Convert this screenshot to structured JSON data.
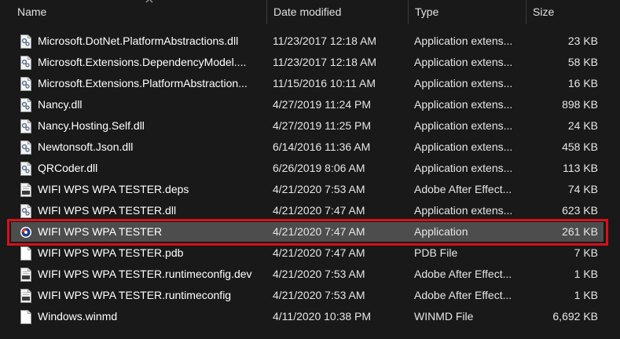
{
  "columns": {
    "name": "Name",
    "date": "Date modified",
    "type": "Type",
    "size": "Size"
  },
  "files": [
    {
      "name": "Microsoft.DotNet.PlatformAbstractions.dll",
      "date": "11/23/2017 12:18 AM",
      "type": "Application extens...",
      "size": "23 KB",
      "icon": "dll-gear-icon"
    },
    {
      "name": "Microsoft.Extensions.DependencyModel....",
      "date": "11/23/2017 12:18 AM",
      "type": "Application extens...",
      "size": "58 KB",
      "icon": "dll-gear-icon"
    },
    {
      "name": "Microsoft.Extensions.PlatformAbstraction...",
      "date": "11/15/2016 10:11 AM",
      "type": "Application extens...",
      "size": "16 KB",
      "icon": "dll-gear-icon"
    },
    {
      "name": "Nancy.dll",
      "date": "4/27/2019 11:24 PM",
      "type": "Application extens...",
      "size": "898 KB",
      "icon": "dll-gear-icon"
    },
    {
      "name": "Nancy.Hosting.Self.dll",
      "date": "4/27/2019 11:25 PM",
      "type": "Application extens...",
      "size": "24 KB",
      "icon": "dll-gear-icon"
    },
    {
      "name": "Newtonsoft.Json.dll",
      "date": "6/14/2016 11:36 AM",
      "type": "Application extens...",
      "size": "458 KB",
      "icon": "dll-gear-icon"
    },
    {
      "name": "QRCoder.dll",
      "date": "6/26/2019 8:06 AM",
      "type": "Application extens...",
      "size": "113 KB",
      "icon": "dll-gear-icon"
    },
    {
      "name": "WIFI WPS WPA TESTER.deps",
      "date": "4/21/2020 7:53 AM",
      "type": "Adobe After Effect...",
      "size": "74 KB",
      "icon": "json-file-icon"
    },
    {
      "name": "WIFI WPS WPA TESTER.dll",
      "date": "4/21/2020 7:47 AM",
      "type": "Application extens...",
      "size": "623 KB",
      "icon": "dll-gear-icon"
    },
    {
      "name": "WIFI WPS WPA TESTER",
      "date": "4/21/2020 7:47 AM",
      "type": "Application",
      "size": "261 KB",
      "icon": "application-icon",
      "selected": true
    },
    {
      "name": "WIFI WPS WPA TESTER.pdb",
      "date": "4/21/2020 7:47 AM",
      "type": "PDB File",
      "size": "7 KB",
      "icon": "blank-file-icon"
    },
    {
      "name": "WIFI WPS WPA TESTER.runtimeconfig.dev",
      "date": "4/21/2020 7:53 AM",
      "type": "Adobe After Effect...",
      "size": "1 KB",
      "icon": "json-file-icon"
    },
    {
      "name": "WIFI WPS WPA TESTER.runtimeconfig",
      "date": "4/21/2020 7:53 AM",
      "type": "Adobe After Effect...",
      "size": "1 KB",
      "icon": "json-file-icon"
    },
    {
      "name": "Windows.winmd",
      "date": "4/11/2020 10:38 PM",
      "type": "WINMD File",
      "size": "6,692 KB",
      "icon": "blank-file-icon"
    }
  ],
  "colors": {
    "background": "#191919",
    "selection": "#4d4d4d",
    "highlight_border": "#d8101a"
  }
}
